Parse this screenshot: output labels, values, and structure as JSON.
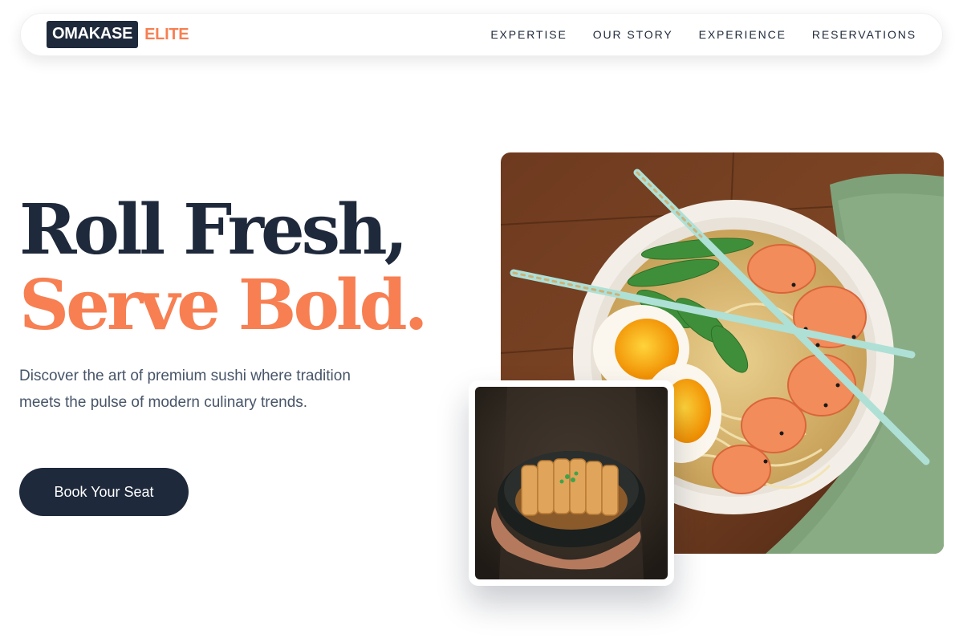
{
  "brand": {
    "name": "OMAKASE",
    "accent": "ELITE"
  },
  "nav": {
    "links": [
      "EXPERTISE",
      "OUR STORY",
      "EXPERIENCE",
      "RESERVATIONS"
    ]
  },
  "hero": {
    "headline_line1": "Roll Fresh,",
    "headline_line2": "Serve Bold.",
    "subtext": "Discover the art of premium sushi where tradition meets the pulse of modern culinary trends.",
    "cta_label": "Book Your Seat"
  },
  "colors": {
    "navy": "#1e293b",
    "accent": "#f77f52",
    "body_text": "#475569",
    "background": "#ffffff"
  },
  "icons": {
    "main_photo": "ramen-bowl-photo",
    "secondary_photo": "katsu-bowl-photo"
  }
}
